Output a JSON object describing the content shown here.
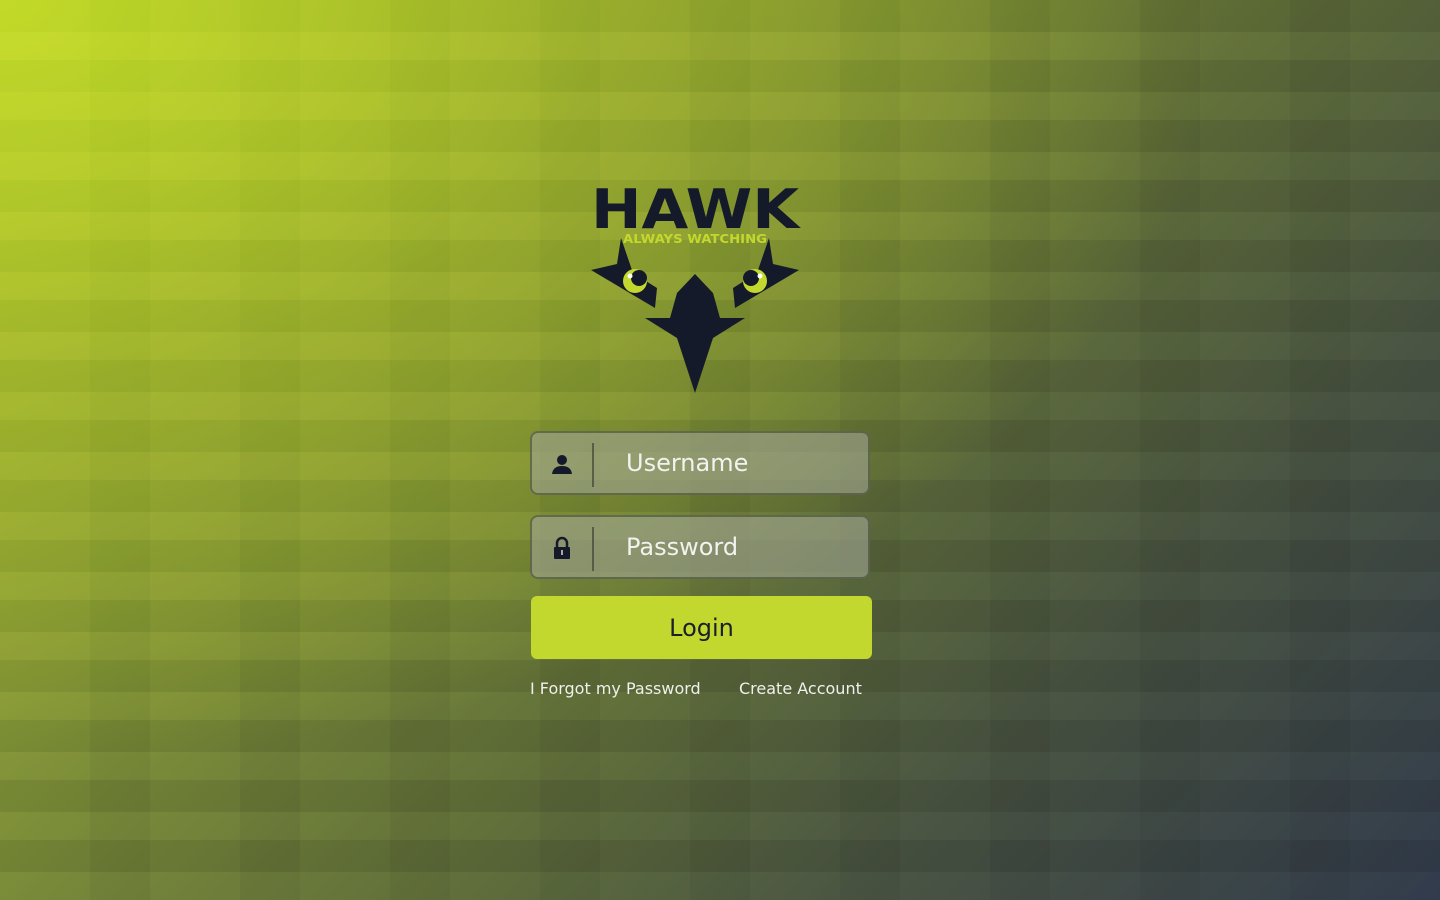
{
  "logo": {
    "title": "HAWK",
    "tagline": "ALWAYS WATCHING",
    "colors": {
      "dark": "#151a2a",
      "accent": "#c3d82e"
    }
  },
  "form": {
    "username": {
      "placeholder": "Username",
      "value": "",
      "icon": "user-icon"
    },
    "password": {
      "placeholder": "Password",
      "value": "",
      "icon": "lock-icon"
    },
    "login_label": "Login",
    "forgot_label": "I Forgot my Password",
    "create_label": "Create Account"
  }
}
